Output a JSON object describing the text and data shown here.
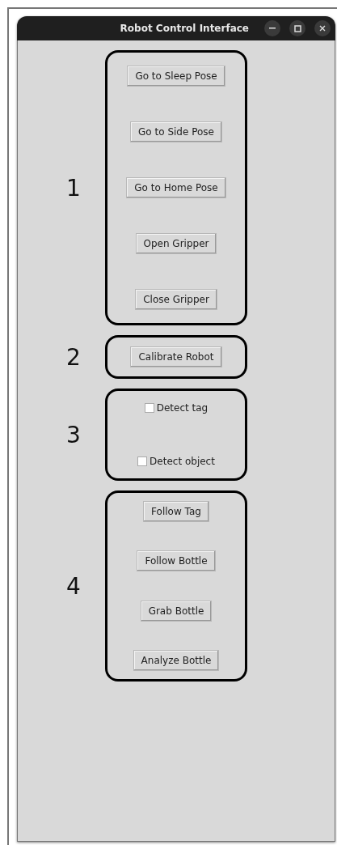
{
  "window": {
    "title": "Robot Control Interface"
  },
  "groups": [
    {
      "label": "1",
      "items": [
        {
          "kind": "button",
          "label": "Go to Sleep Pose"
        },
        {
          "kind": "button",
          "label": "Go to Side Pose"
        },
        {
          "kind": "button",
          "label": "Go to Home Pose"
        },
        {
          "kind": "button",
          "label": "Open Gripper"
        },
        {
          "kind": "button",
          "label": "Close Gripper"
        }
      ]
    },
    {
      "label": "2",
      "items": [
        {
          "kind": "button",
          "label": "Calibrate Robot"
        }
      ]
    },
    {
      "label": "3",
      "items": [
        {
          "kind": "checkbox",
          "label": "Detect tag",
          "checked": false
        },
        {
          "kind": "checkbox",
          "label": "Detect object",
          "checked": false
        }
      ]
    },
    {
      "label": "4",
      "items": [
        {
          "kind": "button",
          "label": "Follow Tag"
        },
        {
          "kind": "button",
          "label": "Follow Bottle"
        },
        {
          "kind": "button",
          "label": "Grab Bottle"
        },
        {
          "kind": "button",
          "label": "Analyze Bottle"
        }
      ]
    }
  ]
}
